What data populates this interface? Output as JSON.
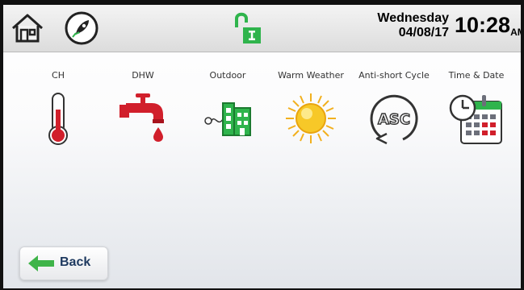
{
  "header": {
    "day": "Wednesday",
    "date": "04/08/17",
    "time": "10:28",
    "ampm": "AM"
  },
  "icons": [
    {
      "label": "CH",
      "icon": "thermometer-icon"
    },
    {
      "label": "DHW",
      "icon": "faucet-icon"
    },
    {
      "label": "Outdoor",
      "icon": "outdoor-building-icon"
    },
    {
      "label": "Warm Weather",
      "icon": "sun-icon"
    },
    {
      "label": "Anti-short Cycle",
      "icon": "asc-cycle-icon"
    },
    {
      "label": "Time & Date",
      "icon": "clock-calendar-icon"
    }
  ],
  "footer": {
    "back_label": "Back"
  },
  "colors": {
    "accent_green": "#2fb44c",
    "red": "#d11f2b",
    "dark_green": "#1b7a2f"
  }
}
